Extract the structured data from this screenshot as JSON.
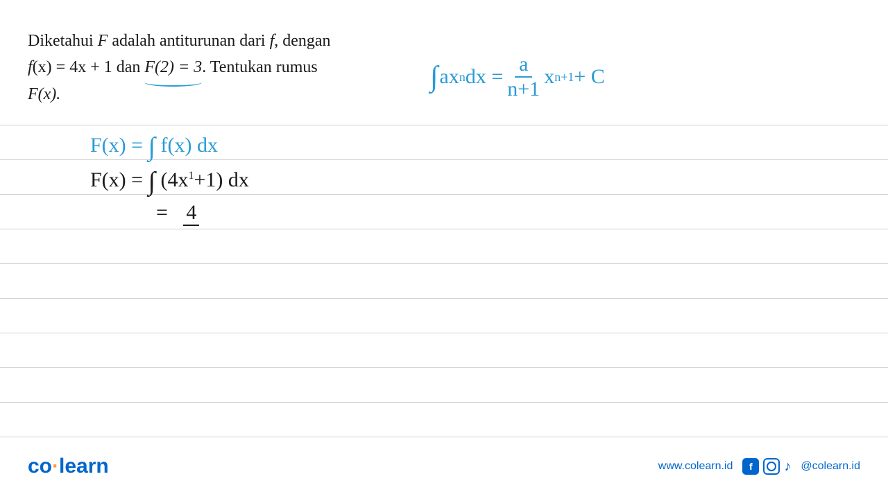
{
  "problem": {
    "line1_pre": "Diketahui ",
    "line1_F": "F",
    "line1_mid": " adalah antiturunan dari ",
    "line1_f": "f",
    "line1_end": ", dengan",
    "line2_pre": "f",
    "line2_paren": "(x) = 4x + 1 dan ",
    "line2_F2": "F(2) = 3",
    "line2_end": ". Tentukan rumus",
    "line3": "F(x)."
  },
  "formula": {
    "int": "∫",
    "ax": "ax",
    "n": "n",
    "dx": "dx = ",
    "num": "a",
    "den": "n+1",
    "x": " x",
    "exp": "n+1",
    "plus_c": " + C"
  },
  "work": {
    "line1": {
      "lhs": "F(x) = ",
      "int": "∫",
      "fx": " f(x) dx"
    },
    "line2": {
      "lhs": "F(x) = ",
      "int": "∫",
      "body": " (4x+1) dx",
      "exp1": "1"
    },
    "line3": {
      "eq": "= ",
      "val": "4"
    }
  },
  "footer": {
    "logo_co": "co",
    "logo_learn": "learn",
    "url": "www.colearn.id",
    "handle": "@colearn.id"
  }
}
